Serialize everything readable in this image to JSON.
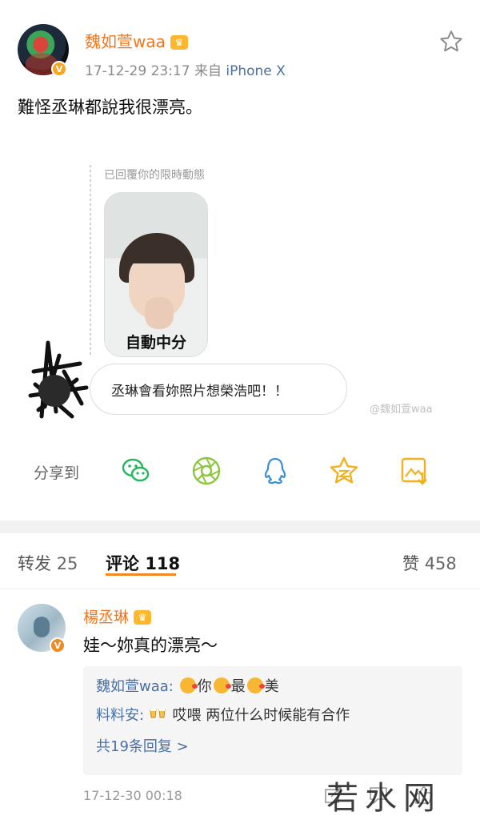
{
  "post": {
    "username": "魏如萱waa",
    "crown_icon": "vip-crown-icon",
    "timestamp": "17-12-29 23:17",
    "source_prefix": "来自",
    "source": "iPhone X",
    "text": "難怪丞琳都說我很漂亮。",
    "story_label": "已回覆你的限時動態",
    "story_caption": "自動中分",
    "reply_text": "丞琳會看妳照片想榮浩吧！！",
    "watermark": "@魏如萱waa",
    "share_label": "分享到",
    "share_icons": [
      "wechat-icon",
      "moments-icon",
      "qq-icon",
      "qzone-icon",
      "save-image-icon"
    ],
    "colors": {
      "username": "#f0761e",
      "share_green": "#20b85a",
      "share_blue": "#3b8fd9",
      "share_yellow": "#f2b01e"
    }
  },
  "tabs": {
    "repost_label": "转发",
    "repost_count": "25",
    "comment_label": "评论",
    "comment_count": "118",
    "like_label": "赞",
    "like_count": "458"
  },
  "comment": {
    "username": "楊丞琳",
    "text": "娃～妳真的漂亮～",
    "replies": [
      {
        "name": "魏如萱waa:",
        "parts": [
          "你",
          "最",
          "美"
        ]
      },
      {
        "name": "料料安:",
        "text": "哎喂 两位什么时候能有合作"
      }
    ],
    "more_replies": "共19条回复 >",
    "timestamp": "17-12-30 00:18"
  },
  "site_watermark": "若水网"
}
